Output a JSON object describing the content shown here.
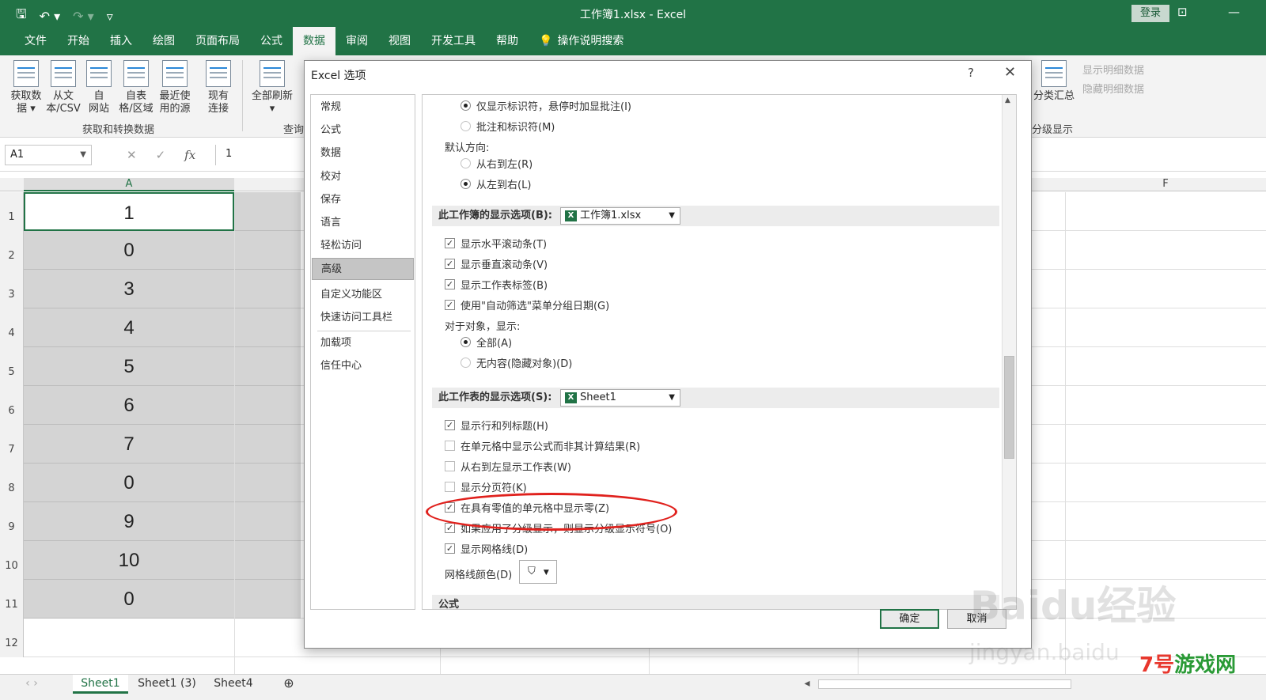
{
  "window": {
    "title": "工作簿1.xlsx  -  Excel",
    "login_label": "登录",
    "qat_icons": [
      "save-icon",
      "undo-icon",
      "redo-icon",
      "customize-icon"
    ]
  },
  "ribbon_tabs": [
    "文件",
    "开始",
    "插入",
    "绘图",
    "页面布局",
    "公式",
    "数据",
    "审阅",
    "视图",
    "开发工具",
    "帮助"
  ],
  "active_tab": "数据",
  "search_label": "操作说明搜索",
  "ribbon": {
    "buttons": [
      {
        "line1": "获取数",
        "line2": "据 ▾"
      },
      {
        "line1": "从文",
        "line2": "本/CSV"
      },
      {
        "line1": "自",
        "line2": "网站"
      },
      {
        "line1": "自表",
        "line2": "格/区域"
      },
      {
        "line1": "最近使",
        "line2": "用的源"
      },
      {
        "line1": "现有",
        "line2": "连接"
      },
      {
        "line1": "全部刷新",
        "line2": "▾"
      }
    ],
    "group1_label": "获取和转换数据",
    "group2_label": "查询",
    "subtotal_label": "分类汇总",
    "show_detail": "显示明细数据",
    "hide_detail": "隐藏明细数据",
    "outline_label": "分级显示"
  },
  "formula_bar": {
    "name_box": "A1",
    "cancel": "✕",
    "enter": "✓",
    "fx": "fx",
    "value": "1"
  },
  "grid": {
    "col_a": "A",
    "col_f": "F",
    "rows": [
      "1",
      "2",
      "3",
      "4",
      "5",
      "6",
      "7",
      "8",
      "9",
      "10",
      "11",
      "12"
    ],
    "values": [
      "1",
      "0",
      "3",
      "4",
      "5",
      "6",
      "7",
      "0",
      "9",
      "10",
      "0"
    ]
  },
  "sheet_tabs": [
    "Sheet1",
    "Sheet1 (3)",
    "Sheet4"
  ],
  "dialog": {
    "title": "Excel 选项",
    "help": "?",
    "close": "✕",
    "nav": [
      "常规",
      "公式",
      "数据",
      "校对",
      "保存",
      "语言",
      "轻松访问",
      "高级",
      "自定义功能区",
      "快速访问工具栏",
      "加载项",
      "信任中心"
    ],
    "selected_nav": "高级",
    "comments_only": "仅显示标识符，悬停时加显批注(I)",
    "comments_and_ind": "批注和标识符(M)",
    "default_direction": "默认方向:",
    "right_to_left": "从右到左(R)",
    "left_to_right": "从左到右(L)",
    "workbook_section": "此工作簿的显示选项(B):",
    "workbook_combo": "工作簿1.xlsx",
    "show_hscroll": "显示水平滚动条(T)",
    "show_vscroll": "显示垂直滚动条(V)",
    "show_sheet_tabs": "显示工作表标签(B)",
    "group_dates": "使用\"自动筛选\"菜单分组日期(G)",
    "for_objects": "对于对象，显示:",
    "all": "全部(A)",
    "nothing": "无内容(隐藏对象)(D)",
    "sheet_section": "此工作表的显示选项(S):",
    "sheet_combo": "Sheet1",
    "show_headers": "显示行和列标题(H)",
    "show_formulas": "在单元格中显示公式而非其计算结果(R)",
    "rtl_sheet": "从右到左显示工作表(W)",
    "page_breaks": "显示分页符(K)",
    "show_zeros": "在具有零值的单元格中显示零(Z)",
    "outline_symbols": "如果应用了分级显示，则显示分级显示符号(O)",
    "gridlines": "显示网格线(D)",
    "gridline_color": "网格线颜色(D)",
    "formula_section": "公式",
    "ok": "确定",
    "cancel": "取消"
  },
  "watermarks": {
    "baidu": "Baidu经验",
    "jingyan": "jingyan.baidu",
    "site_a": "7号",
    "site_b": "游戏网"
  },
  "colors": {
    "excel_green": "#217346",
    "annotation_red": "#e0211d"
  }
}
